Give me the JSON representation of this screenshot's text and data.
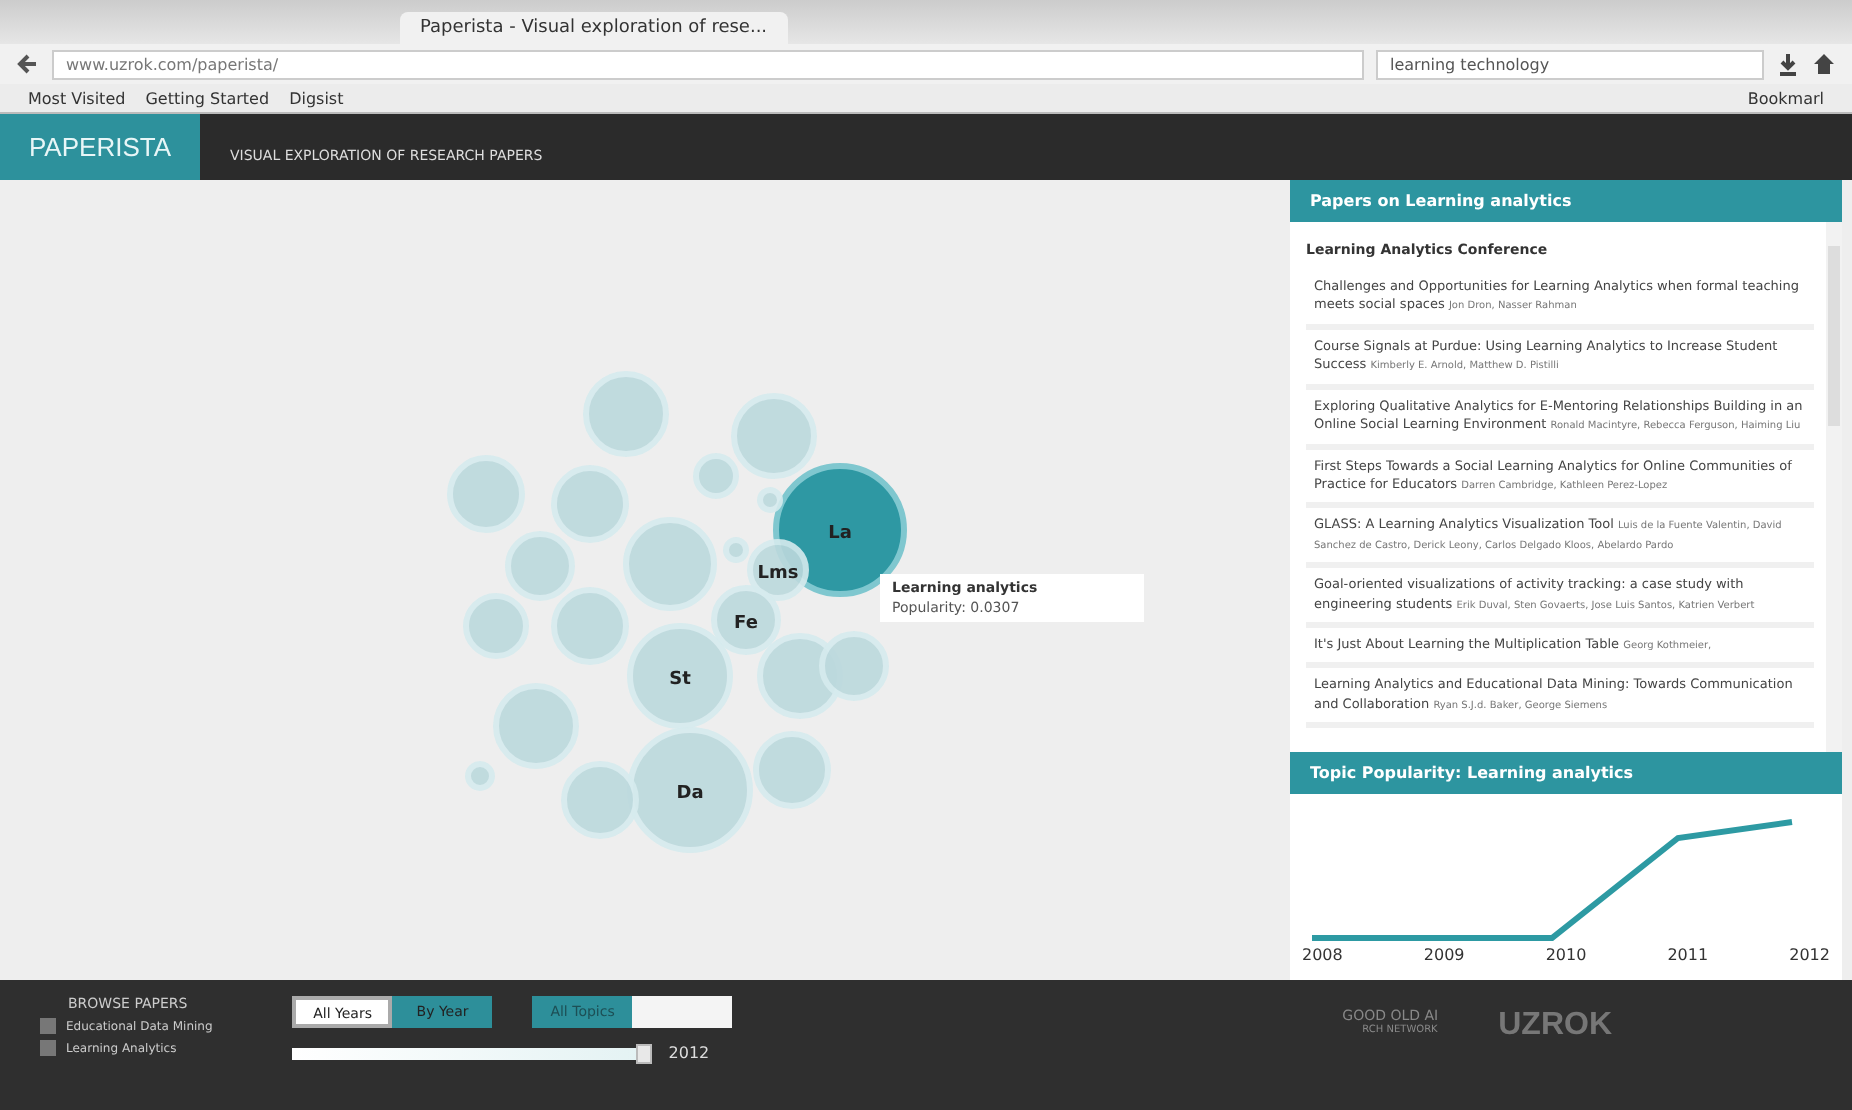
{
  "browser": {
    "tab_title": "Paperista - Visual exploration of rese...",
    "url": "www.uzrok.com/paperista/",
    "search": "learning technology",
    "bookmarks": [
      "Most Visited",
      "Getting Started",
      "Digsist"
    ],
    "bookmarks_menu": "Bookmarl"
  },
  "header": {
    "logo": "PAPERISTA",
    "subtitle": "VISUAL EXPLORATION OF RESEARCH PAPERS"
  },
  "bubbles": [
    {
      "label": "La",
      "selected": true
    },
    {
      "label": "Lms",
      "selected": false
    },
    {
      "label": "Fe",
      "selected": false
    },
    {
      "label": "St",
      "selected": false
    },
    {
      "label": "Da",
      "selected": false
    },
    {
      "selected": false
    },
    {
      "selected": false
    },
    {
      "selected": false
    },
    {
      "selected": false
    },
    {
      "selected": false
    },
    {
      "selected": false
    },
    {
      "selected": false
    },
    {
      "selected": false
    },
    {
      "selected": false
    },
    {
      "selected": false
    },
    {
      "selected": false
    },
    {
      "selected": false
    },
    {
      "selected": false
    },
    {
      "selected": false
    },
    {
      "selected": false
    },
    {
      "selected": false
    },
    {
      "selected": false
    }
  ],
  "tooltip": {
    "title": "Learning analytics",
    "popularity": "Popularity: 0.0307"
  },
  "papers_panel": {
    "title": "Papers on Learning analytics",
    "group": "Learning Analytics Conference",
    "papers": [
      {
        "title": "Challenges and Opportunities for Learning Analytics when formal teaching meets social spaces",
        "authors": "Jon Dron, Nasser Rahman"
      },
      {
        "title": "Course Signals at Purdue: Using Learning Analytics to Increase Student Success",
        "authors": "Kimberly E. Arnold, Matthew D. Pistilli"
      },
      {
        "title": "Exploring Qualitative Analytics for E-Mentoring Relationships Building in an Online Social Learning Environment",
        "authors": "Ronald Macintyre, Rebecca Ferguson, Haiming Liu"
      },
      {
        "title": "First Steps Towards a Social Learning Analytics for Online Communities of Practice for Educators",
        "authors": "Darren Cambridge, Kathleen Perez-Lopez"
      },
      {
        "title": "GLASS: A Learning Analytics Visualization Tool",
        "authors": "Luis de la Fuente Valentin, David Sanchez de Castro, Derick Leony, Carlos Delgado Kloos, Abelardo Pardo"
      },
      {
        "title": "Goal-oriented visualizations of activity tracking: a case study with engineering students",
        "authors": "Erik Duval, Sten Govaerts, Jose Luis Santos, Katrien Verbert"
      },
      {
        "title": "It's Just About Learning the Multiplication Table",
        "authors": "Georg Kothmeier,"
      },
      {
        "title": "Learning Analytics and Educational Data Mining: Towards Communication and Collaboration",
        "authors": "Ryan S.J.d. Baker, George Siemens"
      }
    ]
  },
  "popularity_panel": {
    "title": "Topic Popularity: Learning analytics",
    "axis_labels": [
      "2008",
      "2009",
      "2010",
      "2011",
      "2012"
    ]
  },
  "footer": {
    "heading": "BROWSE PAPERS",
    "legend": [
      {
        "label": "Educational Data Mining",
        "checked": false
      },
      {
        "label": "Learning Analytics",
        "checked": false
      }
    ],
    "year_buttons": [
      {
        "label": "All Years",
        "selected": true
      },
      {
        "label": "By Year",
        "selected": false
      }
    ],
    "topic_buttons": [
      {
        "label": "All Topics",
        "selected": true
      },
      {
        "selected": false
      }
    ],
    "year_slider": {
      "level": 1,
      "reading": "2012"
    },
    "partner": {
      "name": "GOOD OLD AI",
      "sub": "RCH NETWORK"
    },
    "brand": "UZROK"
  }
}
